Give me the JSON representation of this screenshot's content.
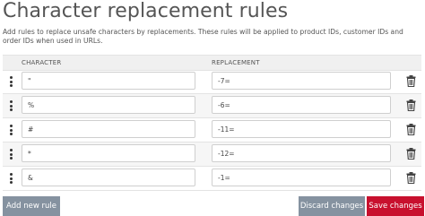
{
  "page": {
    "title": "Character replacement rules",
    "description": "Add rules to replace unsafe characters by replacements. These rules will be applied to product IDs, customer IDs and order IDs when used in URLs."
  },
  "table": {
    "columns": {
      "character": "CHARACTER",
      "replacement": "REPLACEMENT"
    },
    "rows": [
      {
        "character": "\"",
        "replacement": "-7="
      },
      {
        "character": "%",
        "replacement": "-6="
      },
      {
        "character": "#",
        "replacement": "-11="
      },
      {
        "character": "*",
        "replacement": "-12="
      },
      {
        "character": "&",
        "replacement": "-1="
      }
    ]
  },
  "actions": {
    "add_rule": "Add new rule",
    "discard": "Discard changes",
    "save": "Save changes"
  },
  "icons": {
    "drag": "drag-handle-icon",
    "delete": "trash-icon"
  },
  "colors": {
    "secondary_button": "#8592a0",
    "primary_button": "#c8102e"
  }
}
